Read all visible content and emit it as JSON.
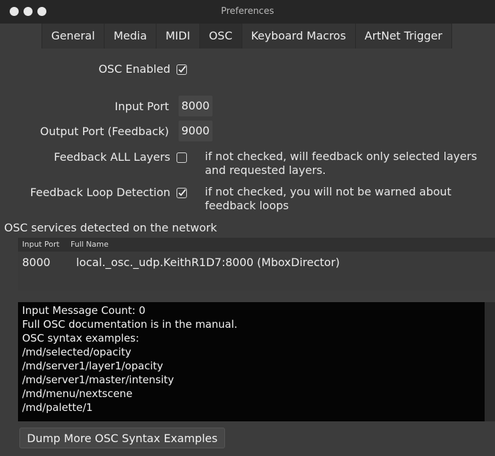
{
  "window": {
    "title": "Preferences"
  },
  "tabs": [
    {
      "label": "General"
    },
    {
      "label": "Media"
    },
    {
      "label": "MIDI"
    },
    {
      "label": "OSC",
      "active": true
    },
    {
      "label": "Keyboard Macros"
    },
    {
      "label": "ArtNet Trigger"
    }
  ],
  "osc": {
    "enabled_label": "OSC Enabled",
    "enabled_checked": true,
    "input_port_label": "Input Port",
    "input_port_value": "8000",
    "output_port_label": "Output Port (Feedback)",
    "output_port_value": "9000",
    "feedback_all_label": "Feedback ALL Layers",
    "feedback_all_checked": false,
    "feedback_all_note": "if not checked, will feedback only selected layers and requested layers.",
    "loop_detection_label": "Feedback Loop Detection",
    "loop_detection_checked": true,
    "loop_detection_note": "if not checked, you will not be warned about feedback loops"
  },
  "services": {
    "title": "OSC services detected on the network",
    "columns": [
      "Input Port",
      "Full Name"
    ],
    "rows": [
      {
        "port": "8000",
        "name": "local._osc._udp.KeithR1D7:8000 (MboxDirector)"
      }
    ]
  },
  "console": {
    "lines": [
      "Input Message Count: 0",
      "Full OSC documentation is in the manual.",
      "OSC syntax examples:",
      "/md/selected/opacity",
      "/md/server1/layer1/opacity",
      "/md/server1/master/intensity",
      "/md/menu/nextscene",
      "/md/palette/1"
    ]
  },
  "buttons": {
    "dump_label": "Dump More OSC Syntax Examples"
  },
  "colors": {
    "window_bg": "#3c3c3c",
    "titlebar_bg": "#262626",
    "console_bg": "#050505",
    "text": "#e6e6e6"
  }
}
